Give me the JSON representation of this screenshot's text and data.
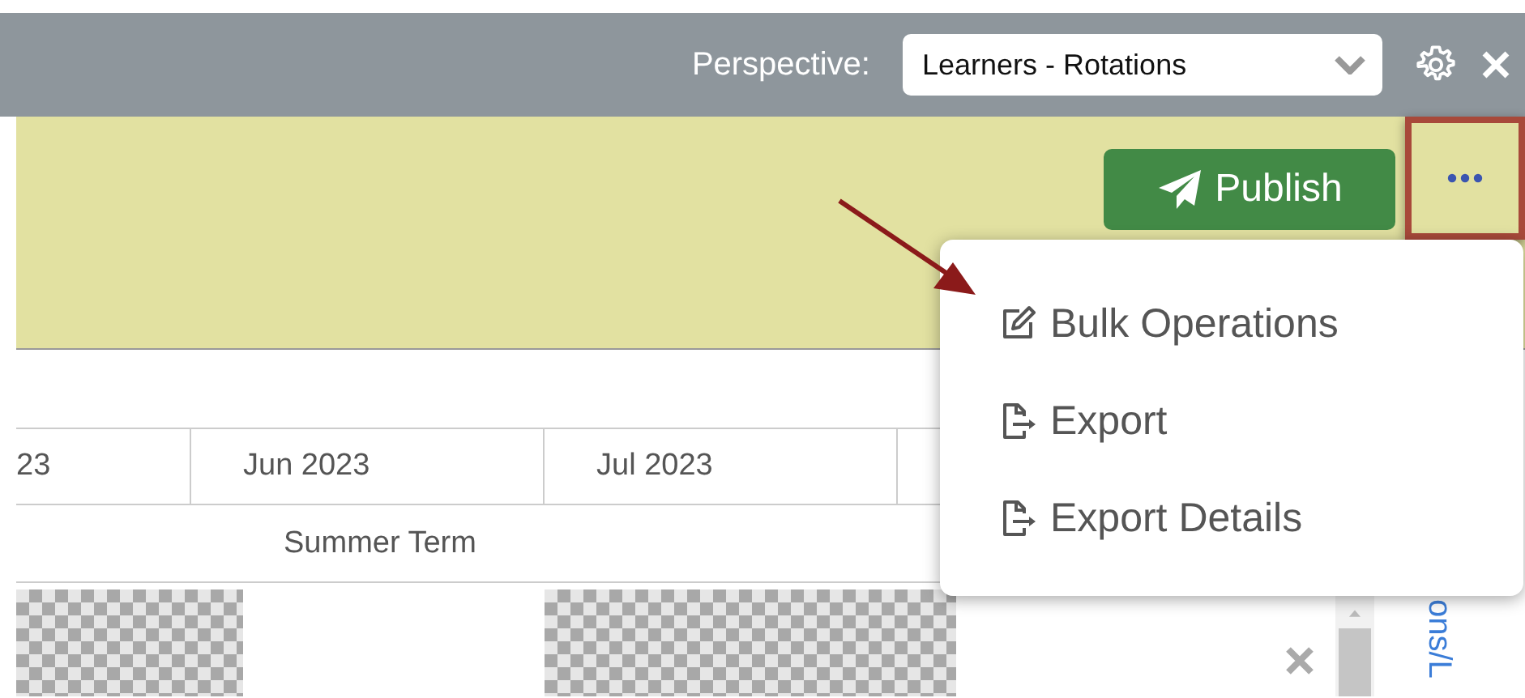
{
  "header": {
    "perspective_label": "Perspective:",
    "perspective_value": "Learners - Rotations"
  },
  "toolbar": {
    "publish_button": "Publish",
    "more_button_highlighted": true
  },
  "menu": {
    "open": true,
    "items": [
      {
        "label": "Bulk Operations",
        "kind": "edit",
        "pointed": true
      },
      {
        "label": "Export",
        "kind": "export",
        "pointed": false
      },
      {
        "label": "Export Details",
        "kind": "export",
        "pointed": false
      }
    ]
  },
  "timeline": {
    "months": [
      "23",
      "Jun 2023",
      "Jul 2023"
    ],
    "term": "Summer Term",
    "cells": [
      {
        "kind": "blocked"
      },
      {
        "kind": "open"
      },
      {
        "kind": "blocked"
      }
    ],
    "side_label": "ons/L"
  }
}
